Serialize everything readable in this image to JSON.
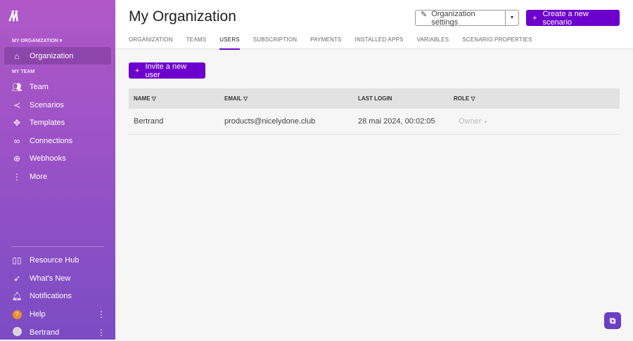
{
  "sidebar": {
    "logo": "M",
    "org_section": "MY ORGANIZATION ▾",
    "team_section": "MY TEAM",
    "items": [
      {
        "label": "Organization",
        "icon": "home-icon"
      },
      {
        "label": "Team",
        "icon": "users-icon"
      },
      {
        "label": "Scenarios",
        "icon": "share-icon"
      },
      {
        "label": "Templates",
        "icon": "puzzle-icon"
      },
      {
        "label": "Connections",
        "icon": "link-icon"
      },
      {
        "label": "Webhooks",
        "icon": "globe-icon"
      },
      {
        "label": "More",
        "icon": "more-icon"
      }
    ],
    "bottom": [
      {
        "label": "Resource Hub",
        "icon": "book-icon"
      },
      {
        "label": "What's New",
        "icon": "rocket-icon"
      },
      {
        "label": "Notifications",
        "icon": "bell-icon"
      },
      {
        "label": "Help",
        "icon": "help-icon"
      },
      {
        "label": "Bertrand",
        "icon": "avatar-icon"
      }
    ]
  },
  "header": {
    "title": "My Organization",
    "settings_label": "Organization settings",
    "create_label": "Create a new scenario",
    "tabs": [
      "ORGANIZATION",
      "TEAMS",
      "USERS",
      "SUBSCRIPTION",
      "PAYMENTS",
      "INSTALLED APPS",
      "VARIABLES",
      "SCENARIO PROPERTIES"
    ],
    "active_tab": "USERS"
  },
  "main": {
    "invite_label": "Invite a new user",
    "columns": [
      "NAME",
      "EMAIL",
      "LAST LOGIN",
      "ROLE"
    ],
    "rows": [
      {
        "name": "Bertrand",
        "email": "products@nicelydone.club",
        "last_login": "28 mai 2024, 00:02:05",
        "role": "Owner"
      }
    ]
  },
  "colors": {
    "accent": "#6d00cc",
    "sidebar_top": "#b158c8",
    "sidebar_bottom": "#7b4cc4"
  }
}
